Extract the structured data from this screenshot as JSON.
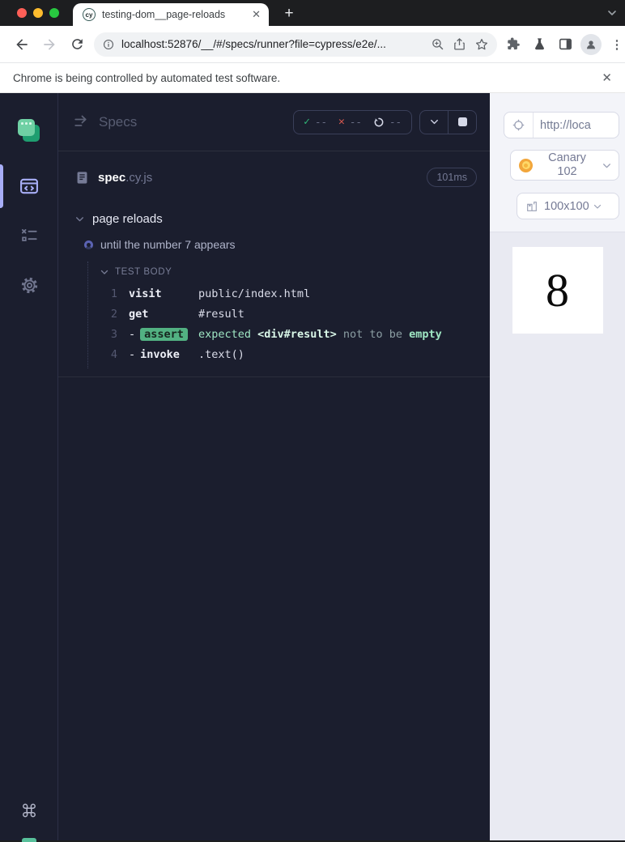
{
  "tabstrip": {
    "tab_title": "testing-dom__page-reloads",
    "favicon_text": "cy",
    "close_label": "✕",
    "new_tab_label": "+"
  },
  "toolbar": {
    "url": "localhost:52876/__/#/specs/runner?file=cypress/e2e/...",
    "menu_dots": "⋮"
  },
  "banner": {
    "message": "Chrome is being controlled by automated test software.",
    "close_label": "✕"
  },
  "reporter": {
    "header": {
      "title": "Specs",
      "passed_count": "--",
      "failed_count": "--",
      "pending_count": "--",
      "pass_mark": "✓",
      "fail_mark": "✕"
    },
    "spec_file": {
      "name": "spec",
      "ext": ".cy.js",
      "duration": "101ms"
    },
    "suite_title": "page reloads",
    "test_title": "until the number 7 appears",
    "section_label": "TEST BODY",
    "commands": [
      {
        "num": "1",
        "name": "visit",
        "args": "public/index.html"
      },
      {
        "num": "2",
        "name": "get",
        "args": "#result"
      },
      {
        "num": "3",
        "dash": "-",
        "name": "assert",
        "expected": "expected",
        "target": "<div#result>",
        "mid": "not to be",
        "value": "empty"
      },
      {
        "num": "4",
        "dash": "-",
        "name": "invoke",
        "args": ".text()"
      }
    ]
  },
  "aut": {
    "url_value": "http://loca",
    "browser_name": "Canary",
    "browser_version": "102",
    "viewport": "100x100",
    "result_value": "8"
  },
  "colors": {
    "pass_green": "#31b979",
    "fail_red": "#d9594f",
    "assert_badge_green": "#52b182",
    "active_lavender": "#a8aef7",
    "cypress_green": "#6fd0a4",
    "reporter_bg": "#1b1e2e",
    "aut_bg": "#e9eaf2"
  }
}
